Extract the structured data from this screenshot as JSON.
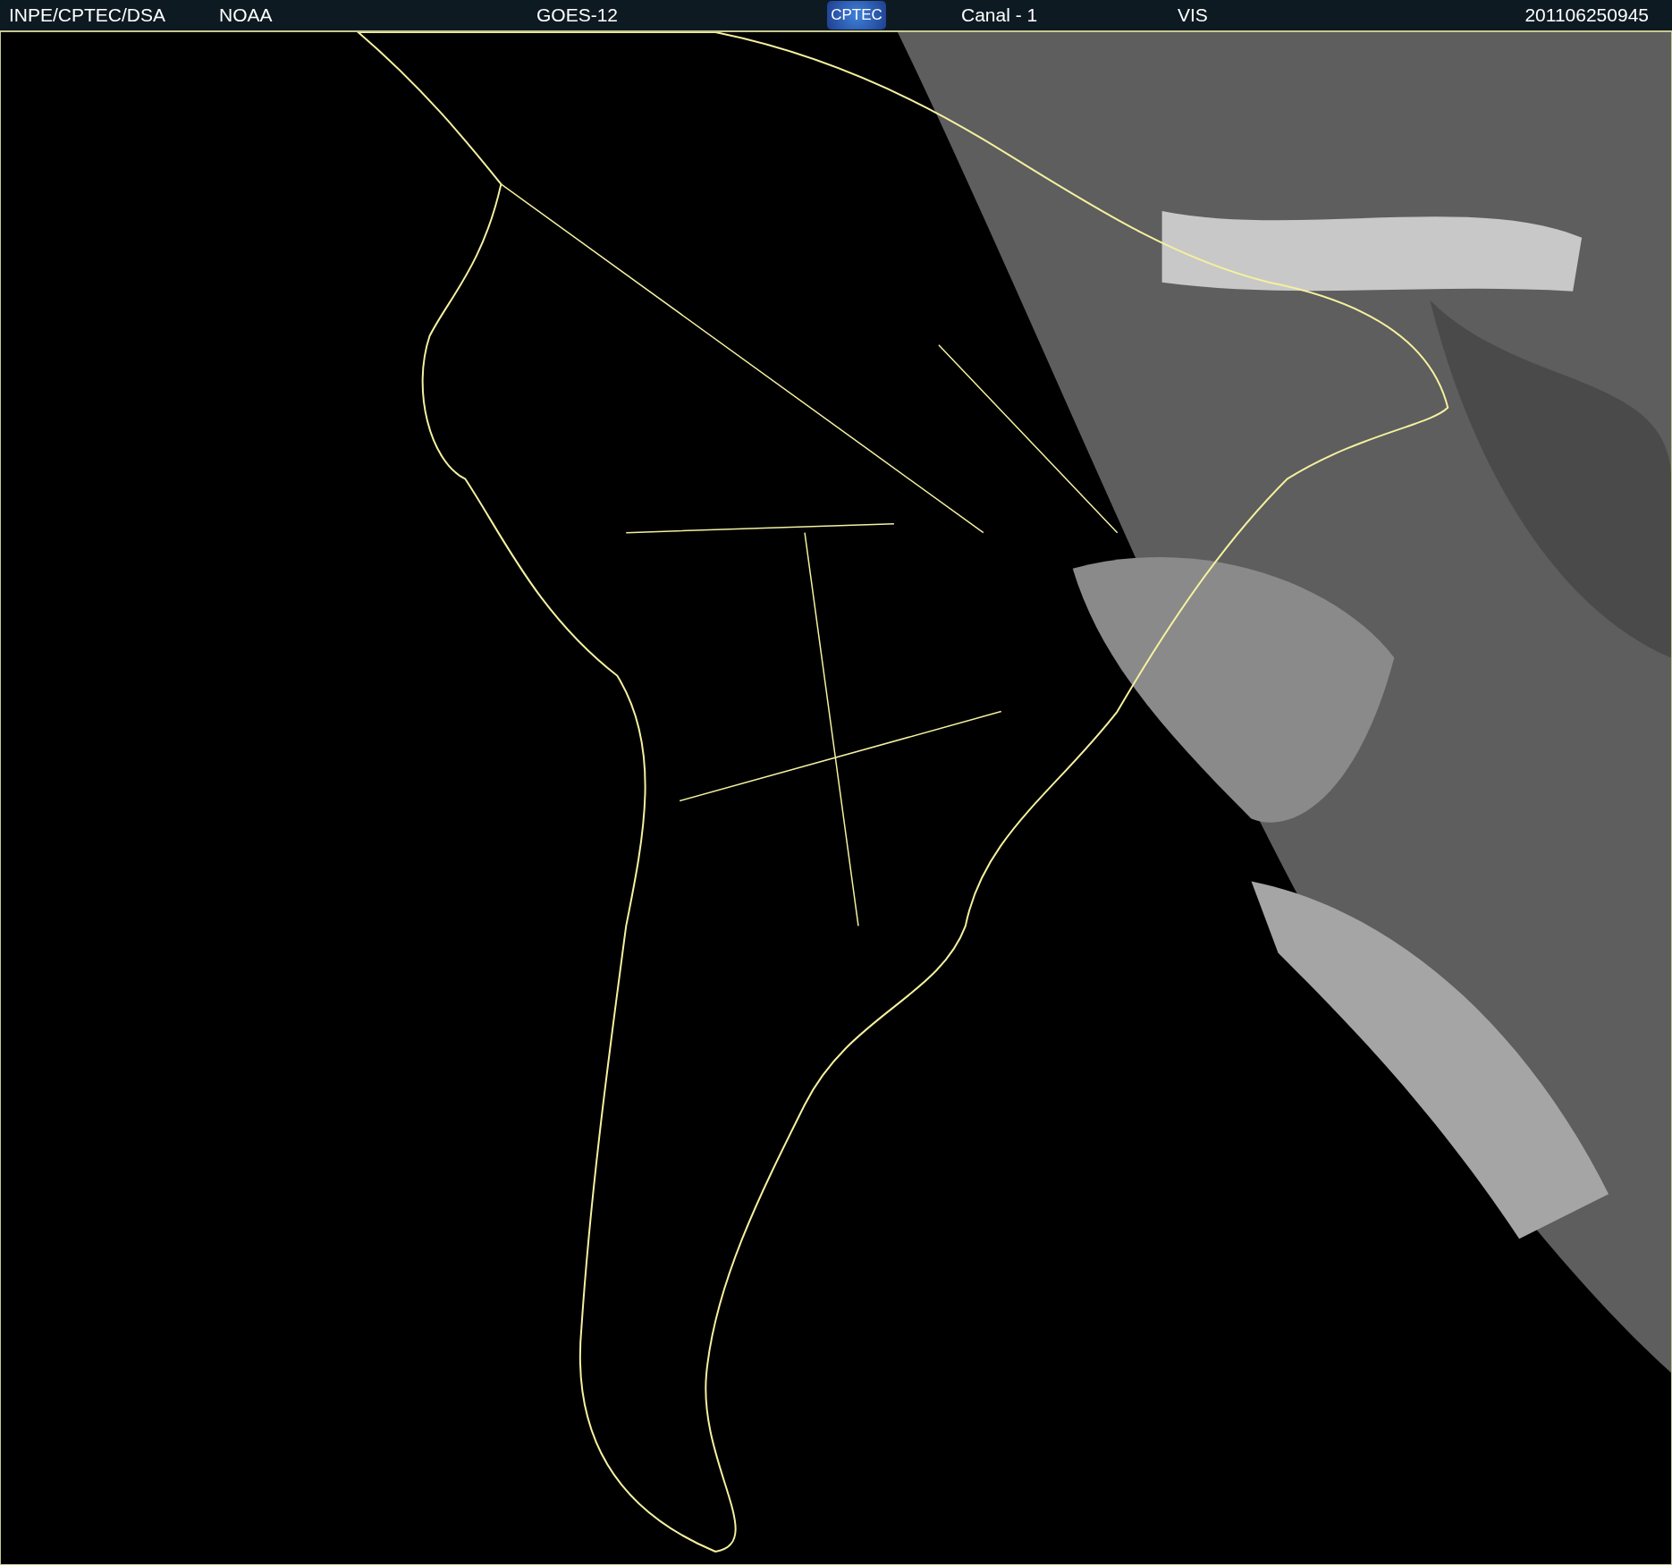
{
  "header": {
    "items": [
      {
        "kind": "text",
        "text": "INPE/CPTEC/DSA"
      },
      {
        "kind": "text",
        "text": "NOAA"
      },
      {
        "kind": "text",
        "text": "GOES-12"
      },
      {
        "kind": "logo",
        "text": "CPTEC"
      },
      {
        "kind": "text",
        "text": "Canal - 1"
      },
      {
        "kind": "text",
        "text": "VIS"
      },
      {
        "kind": "text",
        "text": "201106250945"
      }
    ]
  }
}
